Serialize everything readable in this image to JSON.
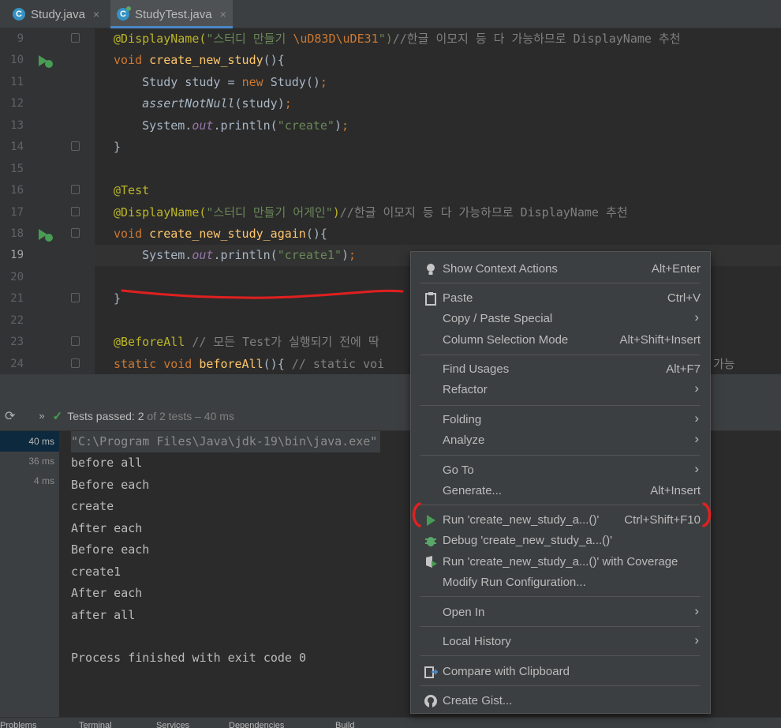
{
  "tabs": [
    {
      "label": "Study.java",
      "icon": "class-icon",
      "letter": "C",
      "close": "×"
    },
    {
      "label": "StudyTest.java",
      "icon": "test-class-icon",
      "letter": "C",
      "close": "×"
    }
  ],
  "editor": {
    "lines": [
      {
        "no": "9"
      },
      {
        "no": "10"
      },
      {
        "no": "11"
      },
      {
        "no": "12"
      },
      {
        "no": "13"
      },
      {
        "no": "14"
      },
      {
        "no": "15"
      },
      {
        "no": "16"
      },
      {
        "no": "17"
      },
      {
        "no": "18"
      },
      {
        "no": "19"
      },
      {
        "no": "20"
      },
      {
        "no": "21"
      },
      {
        "no": "22"
      },
      {
        "no": "23"
      },
      {
        "no": "24"
      }
    ],
    "code": {
      "l9a": "@DisplayName(",
      "l9b": "\"스터디 만들기 ",
      "l9c": "\\uD83D\\uDE31",
      "l9d": "\")",
      "l9e": "//한글 이모지 등 다 가능하므로 DisplayName 추천",
      "l10a": "void ",
      "l10b": "create_new_study",
      "l10c": "(){",
      "l11a": "    Study study = ",
      "l11b": "new ",
      "l11c": "Study()",
      "l11d": ";",
      "l12a": "    assertNotNull",
      "l12b": "(study)",
      "l12c": ";",
      "l13a": "    System.",
      "l13b": "out",
      "l13c": ".println(",
      "l13d": "\"create\"",
      "l13e": ")",
      "l13f": ";",
      "l14": "}",
      "l16": "@Test",
      "l17a": "@DisplayName(",
      "l17b": "\"스터디 만들기 어게인\"",
      "l17c": ")",
      "l17d": "//한글 이모지 등 다 가능하므로 DisplayName 추천",
      "l18a": "void ",
      "l18b": "create_new_study_again",
      "l18c": "(){",
      "l19a": "    System.",
      "l19b": "out",
      "l19c": ".println(",
      "l19d": "\"create1\"",
      "l19e": ")",
      "l19f": ";",
      "l21": "}",
      "l23a": "@BeforeAll",
      "l23b": " // 모든 Test가 실행되기 전에 딱",
      "l24a": "static void ",
      "l24b": "beforeAll",
      "l24c": "(){ ",
      "l24d": "// static voi",
      "l24e": "가능"
    }
  },
  "run": {
    "status_prefix": "Tests passed: ",
    "status_count": "2",
    "status_rest": " of 2 tests – 40 ms",
    "times": [
      "40 ms",
      "36 ms",
      "4 ms"
    ],
    "console": [
      "\"C:\\Program Files\\Java\\jdk-19\\bin\\java.exe\"",
      "before all",
      "Before each",
      "create",
      "After each",
      "Before each",
      "create1",
      "After each",
      "after all",
      "",
      "Process finished with exit code 0"
    ]
  },
  "toolstrip": [
    "Problems",
    "Terminal",
    "Services",
    "Dependencies",
    "Build"
  ],
  "menu": {
    "show_context": {
      "label": "Show Context Actions",
      "shortcut": "Alt+Enter"
    },
    "paste": {
      "label": "Paste",
      "shortcut": "Ctrl+V"
    },
    "copy_paste_special": {
      "label": "Copy / Paste Special"
    },
    "column_selection": {
      "label": "Column Selection Mode",
      "shortcut": "Alt+Shift+Insert"
    },
    "find_usages": {
      "label": "Find Usages",
      "shortcut": "Alt+F7"
    },
    "refactor": {
      "label": "Refactor"
    },
    "folding": {
      "label": "Folding"
    },
    "analyze": {
      "label": "Analyze"
    },
    "go_to": {
      "label": "Go To"
    },
    "generate": {
      "label": "Generate...",
      "shortcut": "Alt+Insert"
    },
    "run": {
      "label": "Run 'create_new_study_a...()'",
      "shortcut": "Ctrl+Shift+F10"
    },
    "debug": {
      "label": "Debug 'create_new_study_a...()'"
    },
    "run_coverage": {
      "label": "Run 'create_new_study_a...()' with Coverage"
    },
    "modify_run": {
      "label": "Modify Run Configuration..."
    },
    "open_in": {
      "label": "Open In"
    },
    "local_history": {
      "label": "Local History"
    },
    "compare_clipboard": {
      "label": "Compare with Clipboard"
    },
    "create_gist": {
      "label": "Create Gist..."
    },
    "arrow": "›"
  },
  "colors": {
    "run_green": "#499c54",
    "debug_green": "#59a869",
    "annotation_red": "#e02020",
    "accent_blue": "#4a88c7"
  }
}
